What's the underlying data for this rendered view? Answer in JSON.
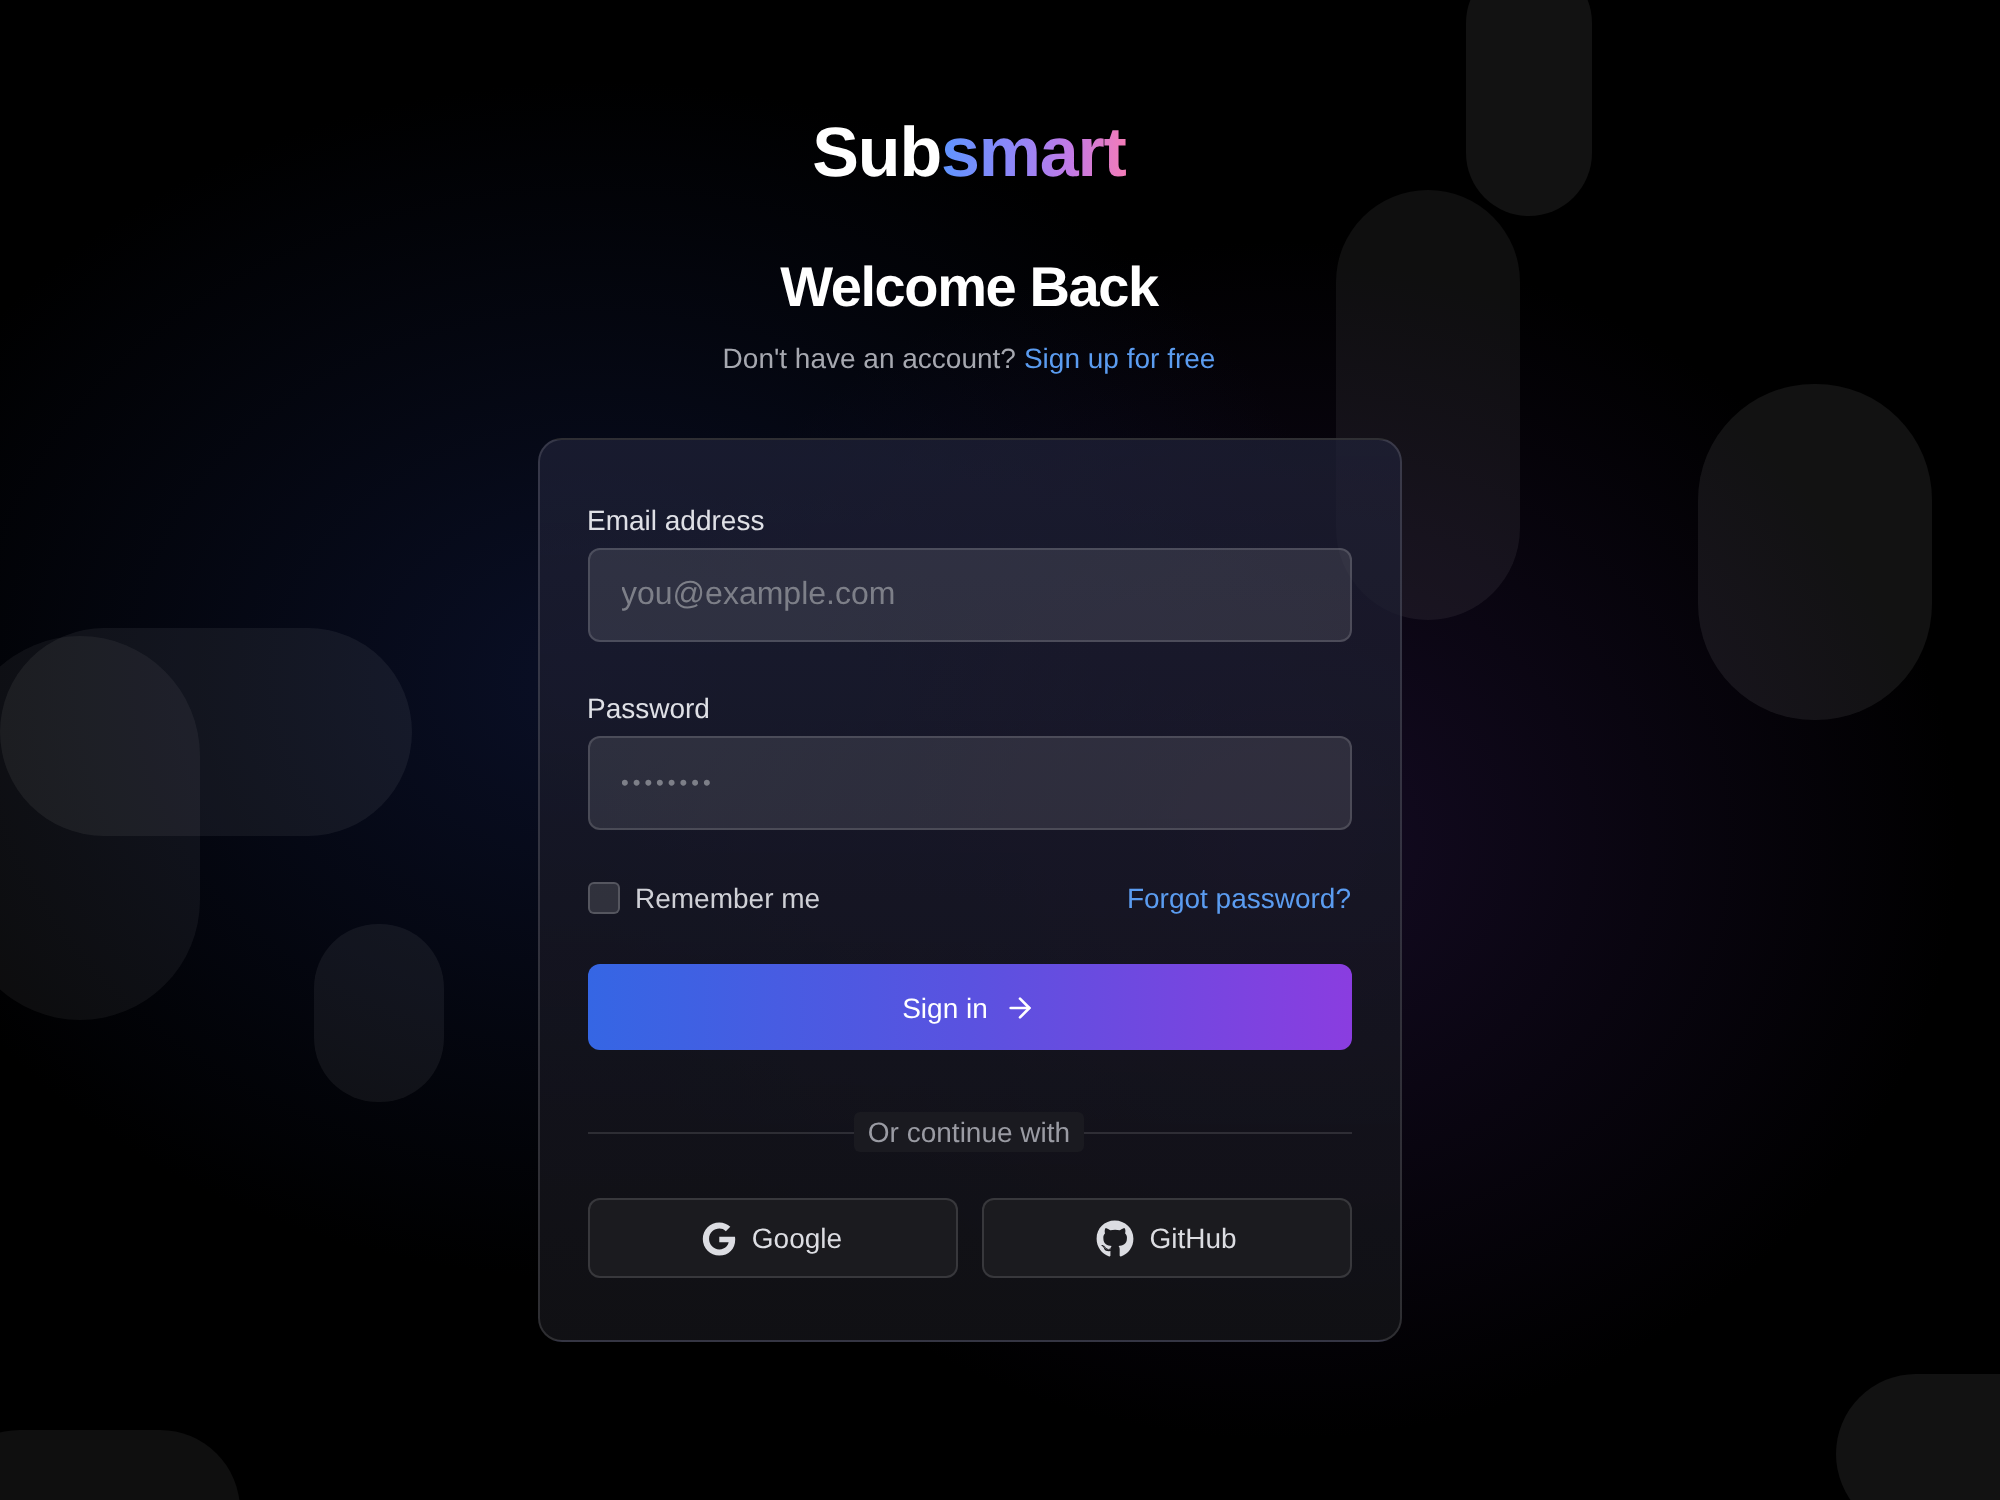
{
  "logo": {
    "text": "Sub",
    "accent": "smart"
  },
  "heading": "Welcome Back",
  "subtitle": {
    "text": "Don't have an account?",
    "link": "Sign up for free"
  },
  "form": {
    "fields": [
      {
        "kind": "email",
        "label": "Email address",
        "placeholder": "you@example.com"
      },
      {
        "kind": "password",
        "label": "Password",
        "placeholder": "••••••••"
      }
    ],
    "remember": {
      "label": "Remember me",
      "checked": false
    },
    "forgot_link": "Forgot password?",
    "submit": "Sign in",
    "divider": "Or continue with",
    "social": [
      {
        "kind": "google",
        "label": "Google"
      },
      {
        "kind": "github",
        "label": "GitHub"
      }
    ]
  }
}
